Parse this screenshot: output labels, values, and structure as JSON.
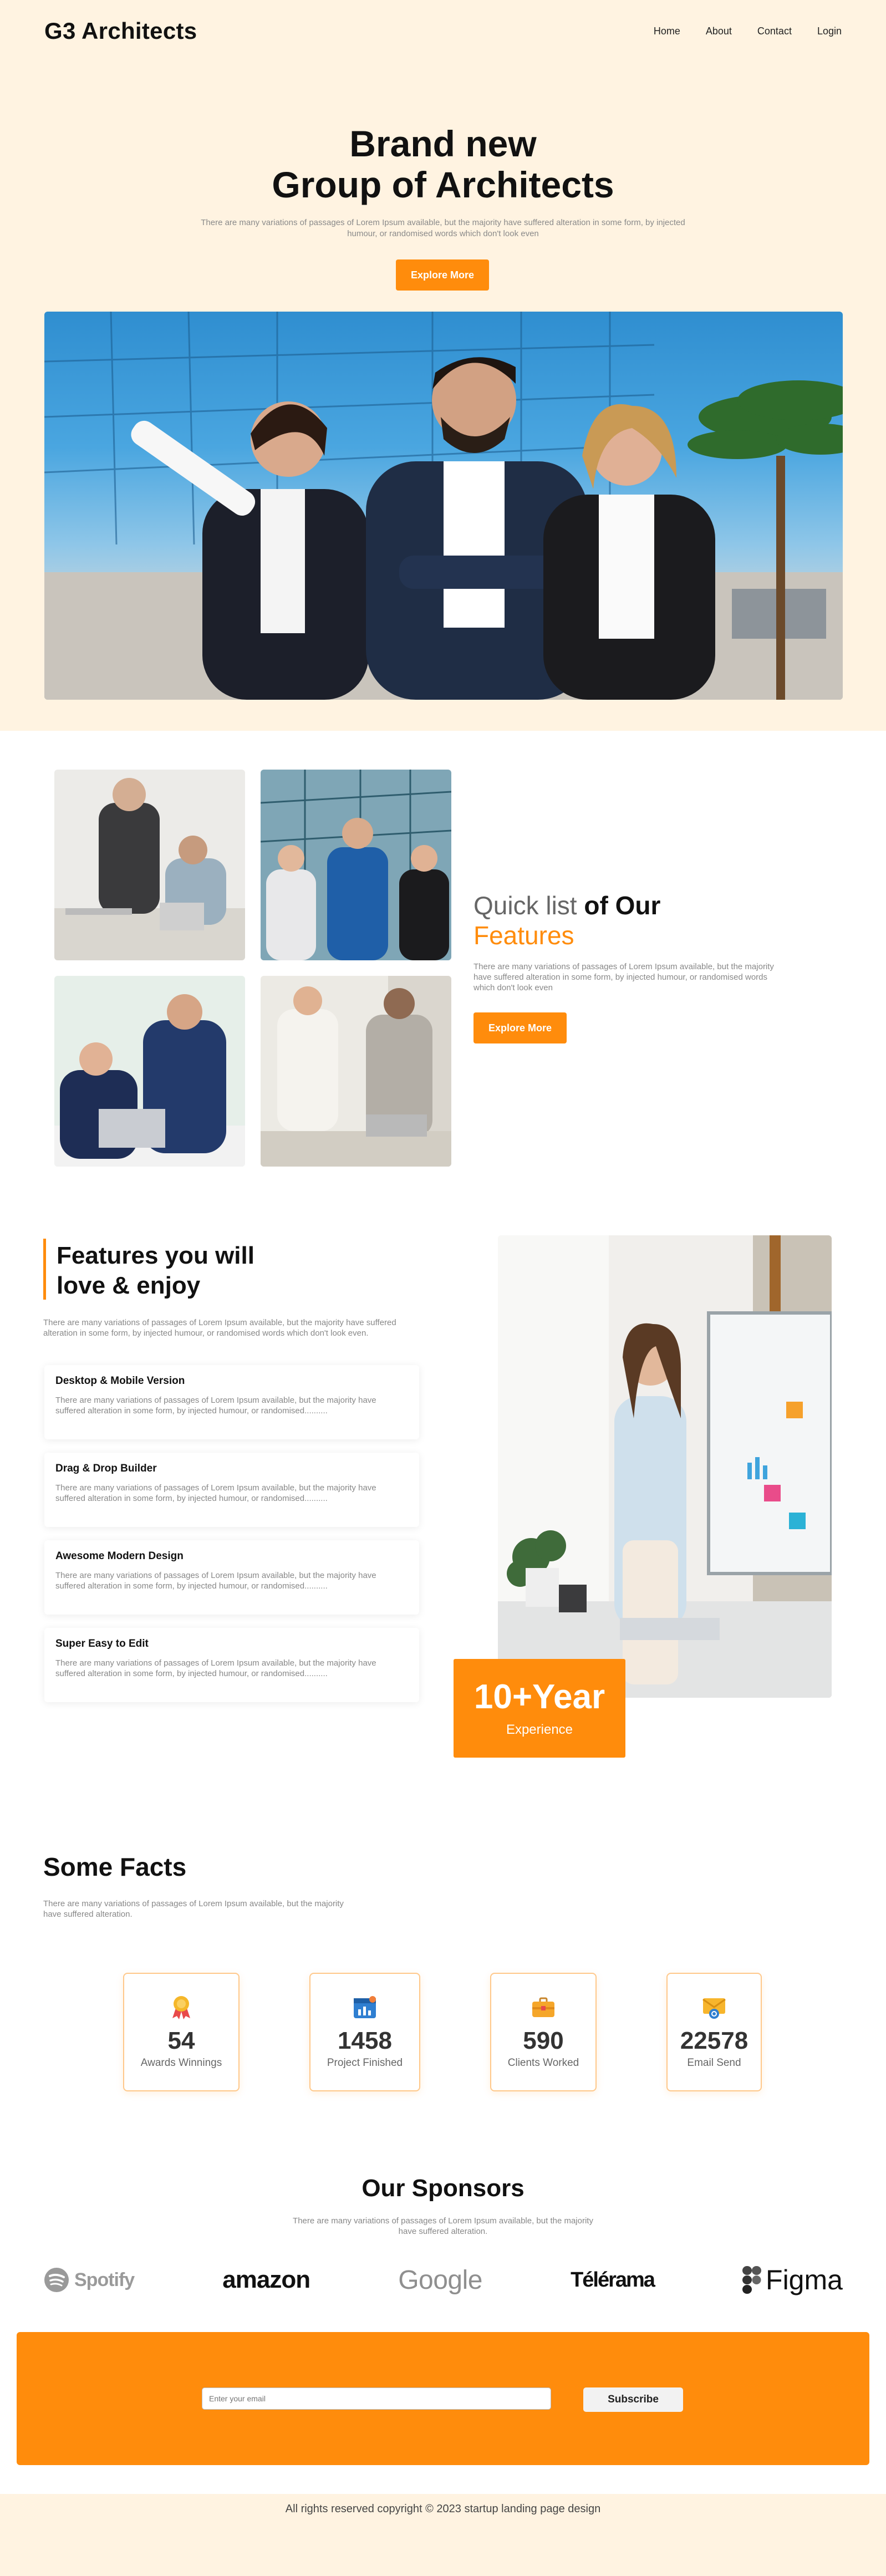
{
  "nav": {
    "logo": "G3 Architects",
    "links": [
      "Home",
      "About",
      "Contact",
      "Login"
    ]
  },
  "hero": {
    "title_line1": "Brand new",
    "title_line2": "Group of Architects",
    "subtitle": "There are many variations of passages of Lorem Ipsum available, but the majority have suffered alteration in some form, by injected humour, or randomised words which don't look even",
    "button": "Explore More"
  },
  "quick": {
    "title_light": "Quick list",
    "title_dark": "of Our",
    "title_orange": "Features",
    "subtitle": "There are many variations of passages of Lorem Ipsum available, but the majority have suffered alteration in some form, by injected humour, or randomised words which don't look even",
    "button": "Explore More"
  },
  "features": {
    "title_line1": "Features you will",
    "title_line2": "love & enjoy",
    "subtitle": "There are many variations of passages of Lorem Ipsum available, but the majority have suffered alteration in some form, by injected humour, or randomised words which don't look even.",
    "cards": [
      {
        "title": "Desktop & Mobile Version",
        "text": "There are many variations of passages of Lorem Ipsum available, but the majority have suffered alteration in some form, by injected humour, or randomised.........."
      },
      {
        "title": "Drag & Drop Builder",
        "text": "There are many variations of passages of Lorem Ipsum available, but the majority have suffered alteration in some form, by injected humour, or randomised.........."
      },
      {
        "title": "Awesome Modern Design",
        "text": "There are many variations of passages of Lorem Ipsum available, but the majority have suffered alteration in some form, by injected humour, or randomised.........."
      },
      {
        "title": "Super Easy to Edit",
        "text": "There are many variations of passages of Lorem Ipsum available, but the majority have suffered alteration in some form, by injected humour, or randomised.........."
      }
    ],
    "experience_value": "10+Year",
    "experience_label": "Experience"
  },
  "facts": {
    "title": "Some Facts",
    "subtitle": "There are many variations of passages of Lorem Ipsum available, but the majority have suffered alteration.",
    "items": [
      {
        "icon": "award-medal-icon",
        "value": "54",
        "label": "Awards Winnings"
      },
      {
        "icon": "calendar-chart-icon",
        "value": "1458",
        "label": "Project Finished"
      },
      {
        "icon": "briefcase-icon",
        "value": "590",
        "label": "Clients Worked"
      },
      {
        "icon": "email-icon",
        "value": "22578",
        "label": "Email Send"
      }
    ]
  },
  "sponsors": {
    "title": "Our Sponsors",
    "subtitle": "There are many variations of passages of Lorem Ipsum available, but the majority have suffered alteration.",
    "logos": [
      "Spotify",
      "amazon",
      "Google",
      "Télérama",
      "Figma"
    ]
  },
  "subscribe": {
    "placeholder": "Enter your email",
    "button": "Subscribe"
  },
  "footer": {
    "text": "All rights reserved copyright © 2023 startup landing page design"
  },
  "colors": {
    "accent": "#ff8c0c",
    "cream": "#fff3e1"
  }
}
